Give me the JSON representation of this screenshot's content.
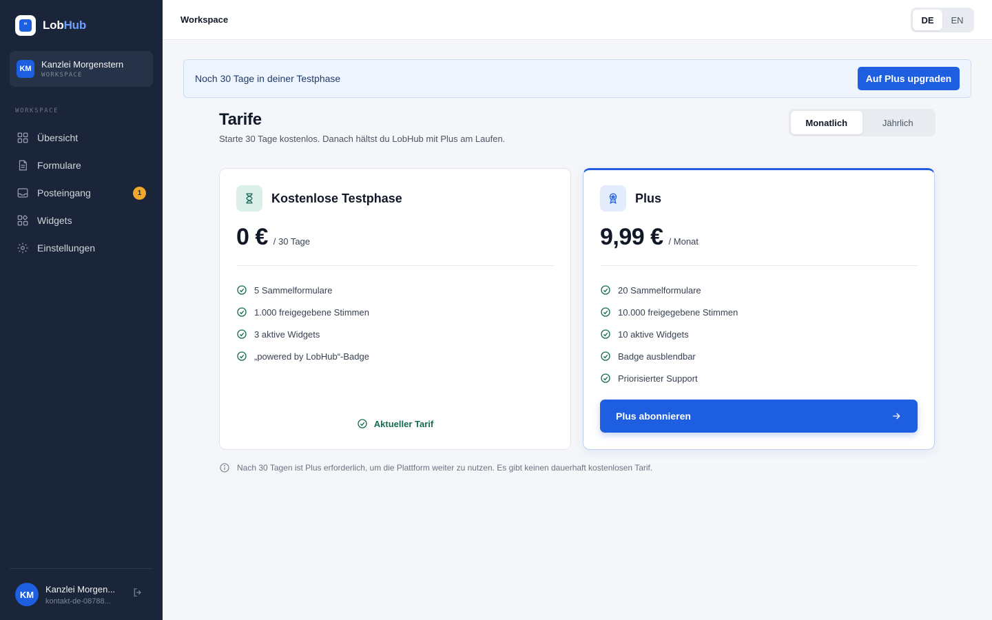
{
  "brand": {
    "name_part1": "Lob",
    "name_part2": "Hub",
    "logo_glyph": "“"
  },
  "workspace": {
    "avatar": "KM",
    "name": "Kanzlei Morgenstern",
    "label": "WORKSPACE"
  },
  "nav": {
    "section": "WORKSPACE",
    "items": [
      {
        "label": "Übersicht",
        "icon": "grid-icon"
      },
      {
        "label": "Formulare",
        "icon": "document-icon"
      },
      {
        "label": "Posteingang",
        "icon": "inbox-icon",
        "badge": "1"
      },
      {
        "label": "Widgets",
        "icon": "widgets-icon"
      },
      {
        "label": "Einstellungen",
        "icon": "gear-icon"
      }
    ]
  },
  "user": {
    "avatar": "KM",
    "name": "Kanzlei Morgen...",
    "email": "kontakt-de-08788..."
  },
  "topbar": {
    "title": "Workspace",
    "lang_de": "DE",
    "lang_en": "EN",
    "active_lang": "DE"
  },
  "banner": {
    "text": "Noch 30 Tage in deiner Testphase",
    "button": "Auf Plus upgraden"
  },
  "page": {
    "title": "Tarife",
    "subtitle": "Starte 30 Tage kostenlos. Danach hältst du LobHub mit Plus am Laufen.",
    "billing_monthly": "Monatlich",
    "billing_yearly": "Jährlich",
    "billing_active": "Monatlich"
  },
  "plans": {
    "free": {
      "title": "Kostenlose Testphase",
      "price": "0 €",
      "unit": "/ 30 Tage",
      "features": [
        "5 Sammelformulare",
        "1.000 freigegebene Stimmen",
        "3 aktive Widgets",
        "„powered by LobHub“-Badge"
      ],
      "current_label": "Aktueller Tarif",
      "icon": "hourglass-icon"
    },
    "plus": {
      "title": "Plus",
      "price": "9,99 €",
      "unit": "/ Monat",
      "features": [
        "20 Sammelformulare",
        "10.000 freigegebene Stimmen",
        "10 aktive Widgets",
        "Badge ausblendbar",
        "Priorisierter Support"
      ],
      "cta": "Plus abonnieren",
      "icon": "award-icon"
    }
  },
  "note": "Nach 30 Tagen ist Plus erforderlich, um die Plattform weiter zu nutzen. Es gibt keinen dauerhaft kostenlosen Tarif.",
  "colors": {
    "sidebar": "#1b2539",
    "accent": "#1d5fe0",
    "success": "#166a55",
    "badge": "#f0a92a"
  }
}
